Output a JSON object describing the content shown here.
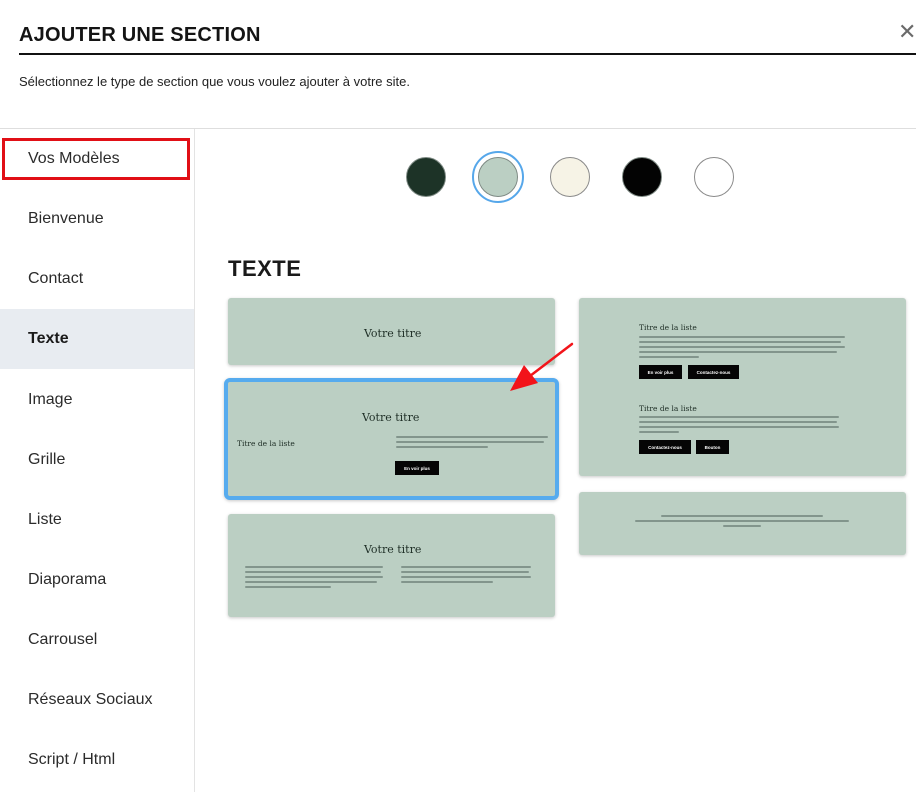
{
  "header": {
    "title": "AJOUTER UNE SECTION",
    "subtitle": "Sélectionnez le type de section que vous voulez ajouter à votre site.",
    "close_glyph": "✕"
  },
  "sidebar": {
    "items": [
      {
        "label": "Vos Modèles",
        "highlighted": true
      },
      {
        "label": "Bienvenue"
      },
      {
        "label": "Contact"
      },
      {
        "label": "Texte",
        "active": true
      },
      {
        "label": "Image"
      },
      {
        "label": "Grille"
      },
      {
        "label": "Liste"
      },
      {
        "label": "Diaporama"
      },
      {
        "label": "Carrousel"
      },
      {
        "label": "Réseaux Sociaux"
      },
      {
        "label": "Script / Html"
      }
    ]
  },
  "palette": {
    "swatches": [
      "#1d3327",
      "#bbcfc3",
      "#f6f3e6",
      "#030303",
      "#ffffff"
    ],
    "selected_index": 1,
    "selected_ring_color": "#56a7ea"
  },
  "section": {
    "heading": "TEXTE"
  },
  "cards": {
    "card1": {
      "title": "Votre titre"
    },
    "card2": {
      "title": "Votre titre",
      "list_title": "Titre de la liste",
      "button": "En voir plus"
    },
    "card3": {
      "title": "Votre titre"
    },
    "card4": {
      "list_title_1": "Titre de la liste",
      "button_1": "En voir plus",
      "button_2": "Contactez-nous",
      "list_title_2": "Titre de la liste",
      "button_3": "Contactez-nous",
      "button_4": "Bouton"
    }
  },
  "colors": {
    "card_bg": "#bbcfc3",
    "selection_border": "#56abee",
    "highlight_red": "#e10f16",
    "arrow_red": "#f2141a"
  }
}
